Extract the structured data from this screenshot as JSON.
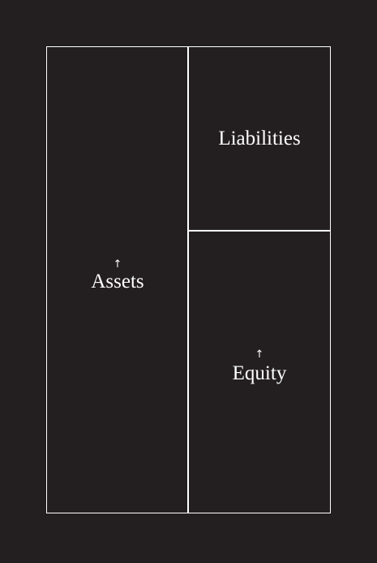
{
  "diagram": {
    "blocks": {
      "assets": {
        "label": "Assets",
        "marker": "↑"
      },
      "liabilities": {
        "label": "Liabilities"
      },
      "equity": {
        "label": "Equity",
        "marker": "↑"
      }
    }
  },
  "colors": {
    "background": "#231f20",
    "lines": "#ffffff",
    "text": "#ffffff"
  }
}
